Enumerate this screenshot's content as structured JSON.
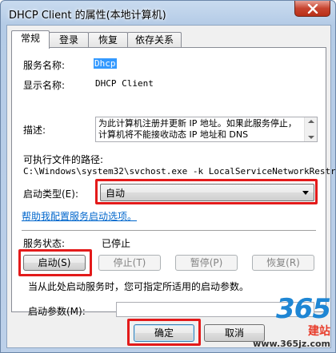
{
  "window": {
    "title": "DHCP Client 的属性(本地计算机)"
  },
  "tabs": [
    "常规",
    "登录",
    "恢复",
    "依存关系"
  ],
  "general": {
    "service_name_label": "服务名称:",
    "service_name_value": "Dhcp",
    "display_name_label": "显示名称:",
    "display_name_value": "DHCP Client",
    "description_label": "描述:",
    "description_value": "为此计算机注册并更新 IP 地址。如果此服务停止，计算机将不能接收动态 IP 地址和 DNS",
    "exe_path_label": "可执行文件的路径:",
    "exe_path_value": "C:\\Windows\\system32\\svchost.exe -k LocalServiceNetworkRestri",
    "startup_type_label": "启动类型(E):",
    "startup_type_value": "自动",
    "help_link": "帮助我配置服务启动选项。",
    "status_label": "服务状态:",
    "status_value": "已停止",
    "buttons": {
      "start": "启动(S)",
      "stop": "停止(T)",
      "pause": "暂停(P)",
      "resume": "恢复(R)"
    },
    "hint": "当从此处启动服务时，您可指定所适用的启动参数。",
    "start_params_label": "启动参数(M):",
    "start_params_value": ""
  },
  "footer": {
    "ok": "确定",
    "cancel": "取消"
  },
  "watermark": {
    "logo": "365",
    "site": "建站",
    "url": "www.365jz.com"
  },
  "colors": {
    "highlight_box": "#e31a1a",
    "link": "#0066cc",
    "selection": "#3399ff"
  }
}
